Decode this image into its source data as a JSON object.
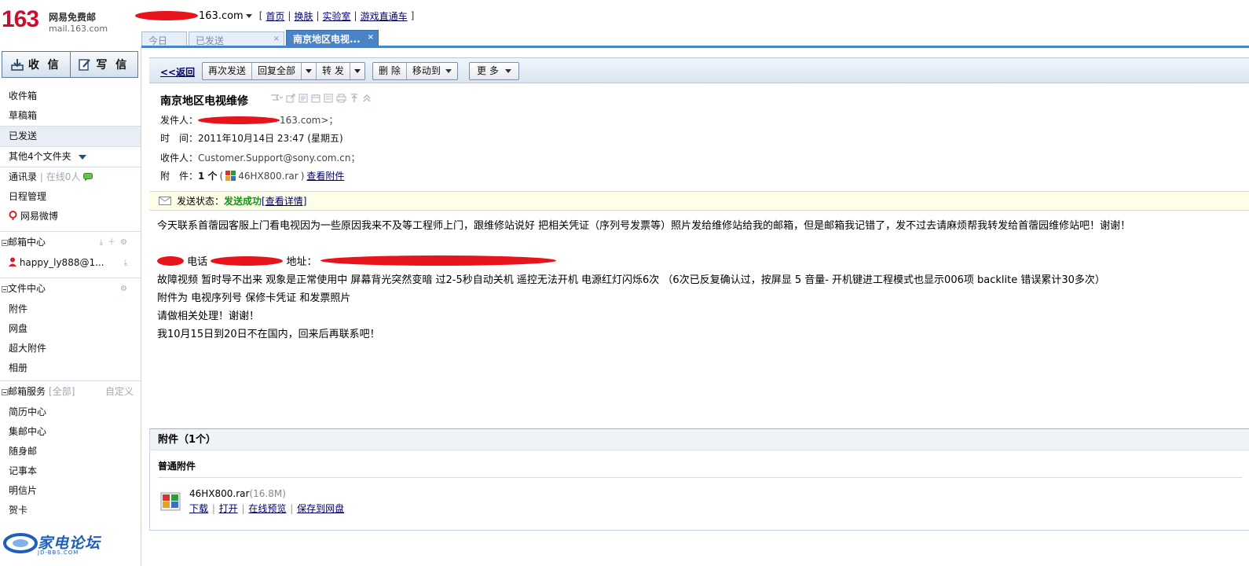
{
  "brand": {
    "logo_number": "163",
    "logo_name": "网易免费邮",
    "logo_url": "mail.163.com"
  },
  "header": {
    "user_domain": "163.com",
    "links": [
      "首页",
      "换肤",
      "实验室",
      "游戏直通车"
    ]
  },
  "tabs": [
    {
      "label": "今日",
      "active": false
    },
    {
      "label": "已发送",
      "active": false,
      "close": "×"
    },
    {
      "label": "南京地区电视...",
      "active": true,
      "close": "×"
    }
  ],
  "sidebar": {
    "receive_label": "收 信",
    "compose_label": "写 信",
    "folders": [
      "收件箱",
      "草稿箱",
      "已发送"
    ],
    "other_folders": "其他4个文件夹",
    "contacts": "通讯录",
    "online": "在线0人",
    "schedule": "日程管理",
    "weibo": "网易微博",
    "mail_center": "邮箱中心",
    "account": "happy_ly888@1...",
    "file_center": "文件中心",
    "file_items": [
      "附件",
      "网盘",
      "超大附件",
      "相册"
    ],
    "services": "邮箱服务",
    "services_all": "[全部]",
    "services_custom": "自定义",
    "service_items": [
      "简历中心",
      "集邮中心",
      "随身邮",
      "记事本",
      "明信片",
      "贺卡"
    ]
  },
  "toolbar": {
    "back": "<<返回",
    "resend": "再次发送",
    "reply_all": "回复全部",
    "forward": "转 发",
    "delete": "删 除",
    "move_to": "移动到",
    "more": "更 多"
  },
  "mail": {
    "subject": "南京地区电视维修",
    "from_label": "发件人：",
    "from_value": "163.com>；",
    "time_label": "时　间：",
    "time_value": "2011年10月14日 23:47 (星期五)",
    "to_label": "收件人：",
    "to_value": "Customer.Support@sony.com.cn；",
    "attach_label": "附　件：",
    "attach_count": "1 个",
    "attach_paren_open": "(",
    "attach_file": "46HX800.rar",
    "attach_paren_close": ")",
    "view_attach": "查看附件",
    "status_label": "发送状态：",
    "status_value": "发送成功",
    "status_detail": "[查看详情]",
    "body": {
      "line1": "今天联系首蓿园客服上门看电视因为一些原因我来不及等工程师上门，跟维修站说好 把相关凭证（序列号发票等）照片发给维修站给我的邮箱，但是邮箱我记错了，发不过去请麻烦帮我转发给首蓿园维修站吧！谢谢！",
      "phone_label": "电话",
      "address_label": "地址：",
      "line3": "故障视频 暂时导不出来 观象是正常使用中 屏幕背光突然变暗 过2-5秒自动关机 遥控无法开机 电源红灯闪烁6次 （6次已反复确认过，按屏显 5 音量- 开机键进工程模式也显示006项 backlite 错误累计30多次）",
      "line4": "附件为 电视序列号 保修卡凭证 和发票照片",
      "line5": "请做相关处理！谢谢！",
      "line6": "我10月15日到20日不在国内，回来后再联系吧！"
    }
  },
  "attachments": {
    "title": "附件（1个）",
    "section": "普通附件",
    "file_name": "46HX800.rar",
    "file_size": "(16.8M)",
    "actions": [
      "下载",
      "打开",
      "在线预览",
      "保存到网盘"
    ]
  },
  "watermark": {
    "name": "家电论坛",
    "url": "JD-BBS.COM"
  },
  "colors": {
    "brand_red": "#c8102e",
    "tab_active": "#4a84c6",
    "link": "#000066",
    "success": "#18911c",
    "redaction": "#e8141b"
  }
}
